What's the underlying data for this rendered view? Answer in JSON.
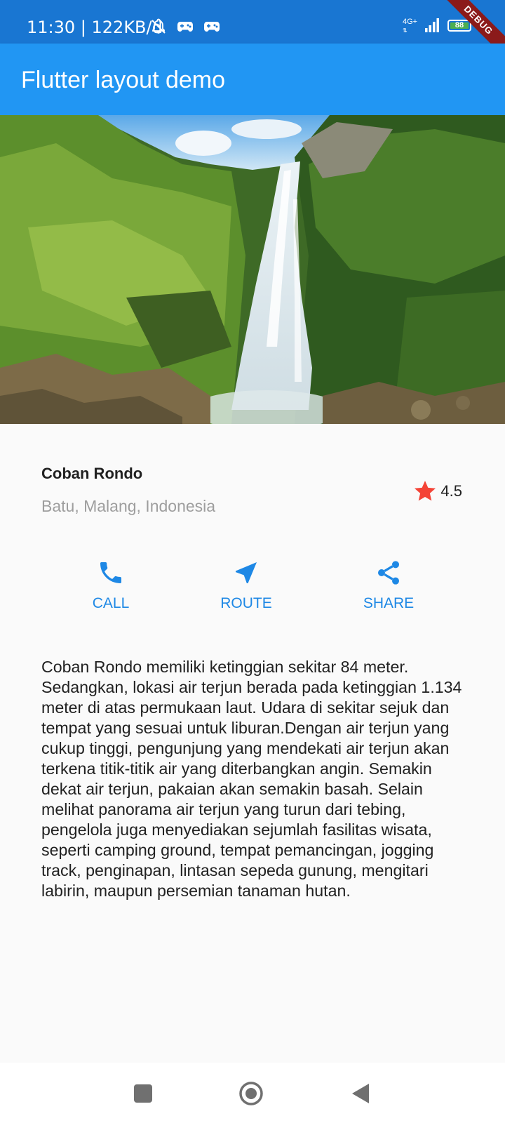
{
  "status_bar": {
    "time": "11:30 | 122KB/d",
    "network_type": "4G+",
    "battery_level": "88"
  },
  "debug_banner": "DEBUG",
  "app_bar": {
    "title": "Flutter layout demo"
  },
  "hero": {
    "subject": "waterfall-photo"
  },
  "place": {
    "name": "Coban Rondo",
    "location": "Batu, Malang, Indonesia",
    "rating": "4.5"
  },
  "actions": [
    {
      "label": "CALL",
      "icon": "phone-icon"
    },
    {
      "label": "ROUTE",
      "icon": "navigation-icon"
    },
    {
      "label": "SHARE",
      "icon": "share-icon"
    }
  ],
  "description": "Coban Rondo memiliki ketinggian sekitar 84 meter. Sedangkan, lokasi air terjun berada pada ketinggian 1.134 meter di atas permukaan laut. Udara di sekitar sejuk dan tempat yang sesuai untuk liburan.Dengan air terjun yang cukup tinggi, pengunjung yang mendekati air terjun akan terkena titik-titik air yang diterbangkan angin. Semakin dekat air terjun, pakaian akan semakin basah. Selain melihat panorama air terjun yang turun dari tebing, pengelola juga menyediakan sejumlah fasilitas wisata, seperti camping ground, tempat pemancingan, jogging track, penginapan, lintasan sepeda gunung, mengitari labirin, maupun persemian tanaman hutan.",
  "colors": {
    "status_bar": "#1976d2",
    "app_bar": "#2196f3",
    "accent": "#1e88e5",
    "star": "#f44336"
  }
}
